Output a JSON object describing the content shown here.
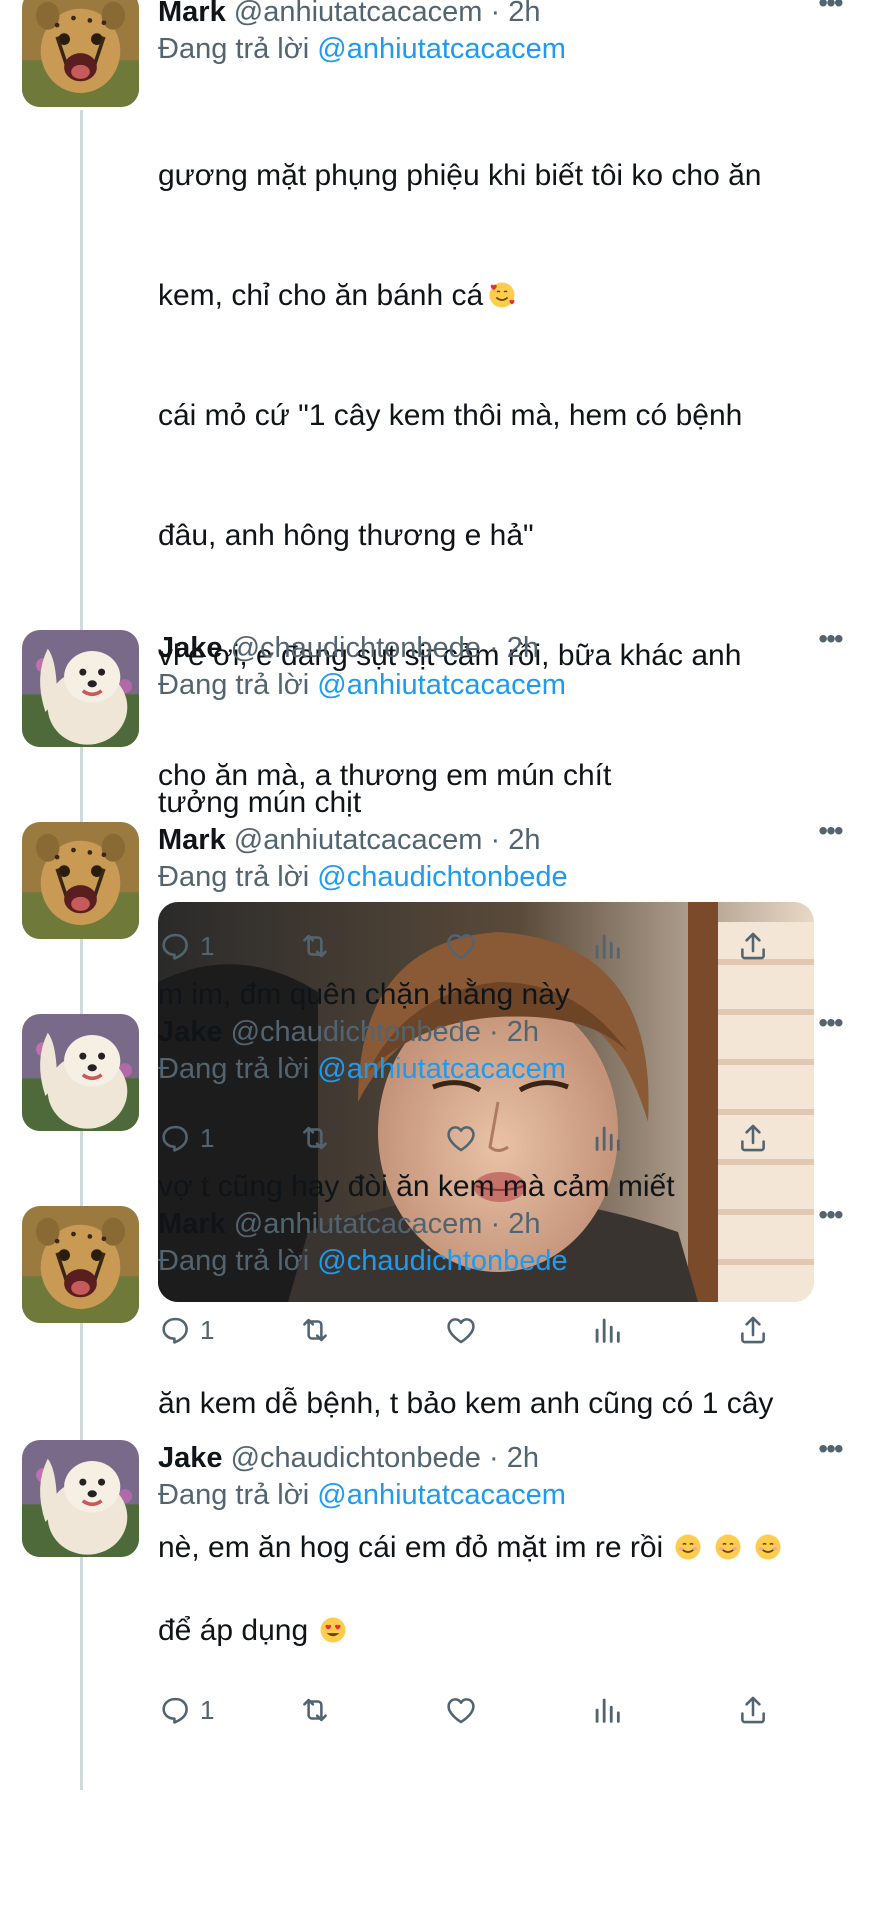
{
  "tweets": [
    {
      "name": "Mark",
      "handle": "@anhiutatcacacem",
      "time": "· 2h",
      "replying_label": "Đang trả lời",
      "replying_to": "@anhiutatcacacem",
      "lines": [
        "gương mặt phụng phiệu khi biết tôi ko cho ăn",
        "kem, chỉ cho ăn bánh cá",
        "cái mỏ cứ \"1 cây kem thôi mà, hem có bệnh",
        "đâu, anh hông thương e hả\"",
        "vl e ơi, e đang sụt sịt cảm rồi, bữa khác anh",
        "cho ăn mà, a thương em mún chít"
      ],
      "emoji_line2": "smiling-face-with-hearts",
      "avatar": "cheetah-cub"
    },
    {
      "name": "Jake",
      "handle": "@chaudichtonbede",
      "time": "· 2h",
      "replying_label": "Đang trả lời",
      "replying_to": "@anhiutatcacacem",
      "lines": [
        "tưởng mún chịt"
      ],
      "reply_count": "1",
      "avatar": "samoyed-dog"
    },
    {
      "name": "Mark",
      "handle": "@anhiutatcacacem",
      "time": "· 2h",
      "replying_label": "Đang trả lời",
      "replying_to": "@chaudichtonbede",
      "lines": [
        "m im, đm quên chặn thằng này"
      ],
      "reply_count": "1",
      "avatar": "cheetah-cub"
    },
    {
      "name": "Jake",
      "handle": "@chaudichtonbede",
      "time": "· 2h",
      "replying_label": "Đang trả lời",
      "replying_to": "@anhiutatcacacem",
      "lines": [
        "vợ t cũng hay đòi ăn kem mà cảm miết"
      ],
      "reply_count": "1",
      "avatar": "samoyed-dog"
    },
    {
      "name": "Mark",
      "handle": "@anhiutatcacacem",
      "time": "· 2h",
      "replying_label": "Đang trả lời",
      "replying_to": "@chaudichtonbede",
      "lines": [
        "ăn kem dễ bệnh, t bảo kem anh cũng có 1 cây",
        "nè, em ăn hog cái em đỏ mặt im re rồi"
      ],
      "emoji_line2": "smiling-face x3",
      "reply_count": "1",
      "avatar": "cheetah-cub"
    },
    {
      "name": "Jake",
      "handle": "@chaudichtonbede",
      "time": "· 2h",
      "replying_label": "Đang trả lời",
      "replying_to": "@anhiutatcacacem",
      "lines": [
        "để áp dụng"
      ],
      "emoji_line1": "heart-eyes",
      "avatar": "samoyed-dog"
    }
  ],
  "icons": {
    "reply": "reply-icon",
    "retweet": "retweet-icon",
    "like": "heart-icon",
    "views": "views-icon",
    "share": "share-icon",
    "more": "more-icon"
  },
  "colors": {
    "mention": "#1d9bf0",
    "secondary_text": "#536471",
    "thread_line": "#cfd9de"
  }
}
